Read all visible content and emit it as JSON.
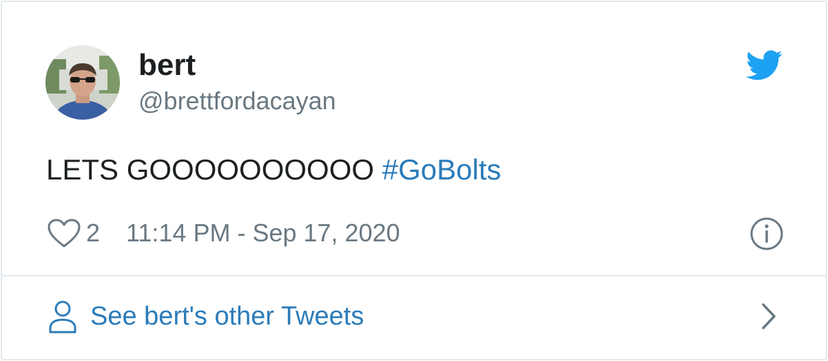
{
  "user": {
    "name": "bert",
    "handle": "@brettfordacayan"
  },
  "tweet": {
    "text": "LETS GOOOOOOOOOO ",
    "hashtag": "#GoBolts"
  },
  "meta": {
    "likes": "2",
    "timestamp": "11:14 PM - Sep 17, 2020"
  },
  "footer": {
    "label": "See bert's other Tweets"
  },
  "icons": {
    "bird": "twitter-bird-icon",
    "heart": "heart-icon",
    "info": "info-icon",
    "person": "person-icon",
    "chevron": "chevron-right-icon"
  },
  "colors": {
    "accent": "#2b7bb9",
    "brand": "#1da1f2",
    "text": "#1c2022",
    "muted": "#697882",
    "border": "#e1e8ed"
  }
}
